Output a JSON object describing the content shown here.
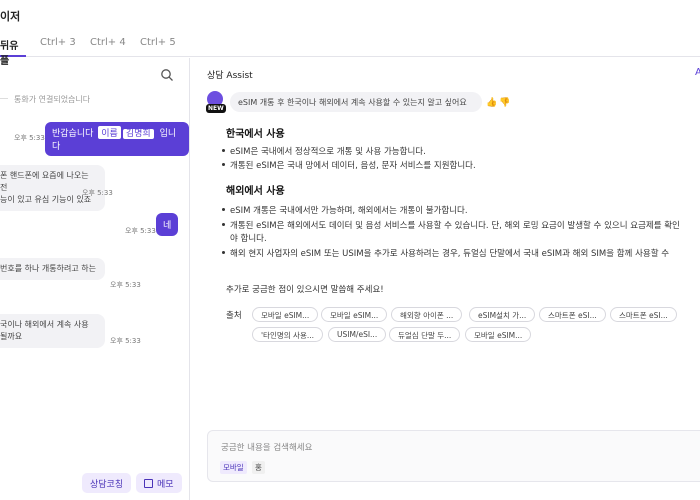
{
  "header": {
    "title": "이저"
  },
  "tabs": [
    {
      "label": "뒤유플",
      "active": true
    },
    {
      "label": "Ctrl+ 3",
      "active": false
    },
    {
      "label": "Ctrl+ 4",
      "active": false
    },
    {
      "label": "Ctrl+ 5",
      "active": false
    }
  ],
  "chat": {
    "search_icon": "search-icon",
    "system_message": "통화가 연결되었습니다",
    "messages": [
      {
        "dir": "out",
        "text_before": "반갑습니다",
        "name": "이름",
        "agent": "김명희",
        "text_after": "입니다",
        "time": "오후 5:33"
      },
      {
        "dir": "in",
        "lines": [
          "폰 핸드폰에 요즘에 나오는 전",
          "능이 있고 유심 기능이 있죠"
        ],
        "time": "오후 5:33"
      },
      {
        "dir": "out",
        "text": "네",
        "time": "오후 5:33"
      },
      {
        "dir": "in",
        "lines": [
          "번호를 하나 개통하려고 하는"
        ],
        "time": "오후 5:33"
      },
      {
        "dir": "in",
        "lines": [
          "국이나 해외에서 계속 사용",
          "될까요"
        ],
        "time": "오후 5:33"
      }
    ],
    "buttons": {
      "coaching": "상담코칭",
      "memo": "메모"
    }
  },
  "assist": {
    "title": "상담 Assist",
    "corner": "A",
    "new_badge": "NEW",
    "question": "eSIM 개통 후 한국이나 해외에서 계속 사용할 수 있는지 알고 싶어요",
    "sections": [
      {
        "heading": "한국에서 사용",
        "items": [
          "eSIM은 국내에서 정상적으로 개통 및 사용 가능합니다.",
          "개통된 eSIM은 국내 망에서 데이터, 음성, 문자 서비스를 지원합니다."
        ]
      },
      {
        "heading": "해외에서 사용",
        "items": [
          "eSIM 개통은 국내에서만 가능하며, 해외에서는 개통이 불가합니다.",
          "개통된 eSIM은 해외에서도 데이터 및 음성 서비스를 사용할 수 있습니다. 단, 해외 로밍 요금이 발생할 수 있으니 요금제를 확인",
          "야 합니다.",
          "해외 현지 사업자의 eSIM 또는 USIM을 추가로 사용하려는 경우, 듀얼심 단말에서 국내 eSIM과 해외 SIM을 함께 사용할 수"
        ]
      }
    ],
    "closing": "추가로 궁금한 점이 있으시면 말씀해 주세요!",
    "sources_label": "출처",
    "sources": [
      "모바일 eSIM...",
      "모바일 eSIM...",
      "해외향 아이폰 ...",
      "eSIM설치 가...",
      "스마트폰 eSI...",
      "스마트폰 eSI...",
      "'타인명의 사용...",
      "USIM/eSI...",
      "듀얼심 단말 두...",
      "모바일 eSIM..."
    ],
    "composer": {
      "placeholder": "궁금한 내용을 검색해세요",
      "filter_on": "모바일",
      "filter_off": "홍"
    }
  },
  "colors": {
    "accent": "#5b3fd6",
    "accent_light": "#efeafd",
    "bubble_in": "#f2f2f5"
  }
}
